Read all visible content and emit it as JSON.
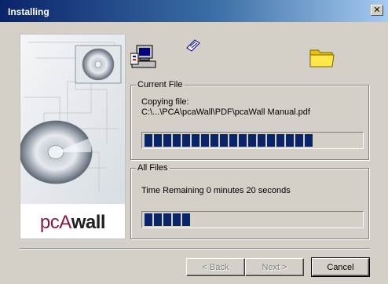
{
  "window": {
    "title": "Installing"
  },
  "branding": {
    "logo_part1": "pcA",
    "logo_part2": "wall"
  },
  "current_file": {
    "legend": "Current File",
    "line1": "Copying file:",
    "line2": "C:\\...\\PCA\\pcaWall\\PDF\\pcaWall Manual.pdf",
    "progress_blocks": 18
  },
  "all_files": {
    "legend": "All Files",
    "status": "Time Remaining 0 minutes 20 seconds",
    "progress_blocks": 5
  },
  "buttons": {
    "back": "< Back",
    "next": "Next >",
    "cancel": "Cancel"
  },
  "colors": {
    "titlebar_start": "#0a246a",
    "titlebar_end": "#a6caf0",
    "progress_fill": "#0a246a",
    "dialog_bg": "#d4d0c8"
  },
  "icons": [
    "close-icon",
    "computer-icon",
    "paper-icon",
    "folder-icon",
    "cd-icon"
  ]
}
